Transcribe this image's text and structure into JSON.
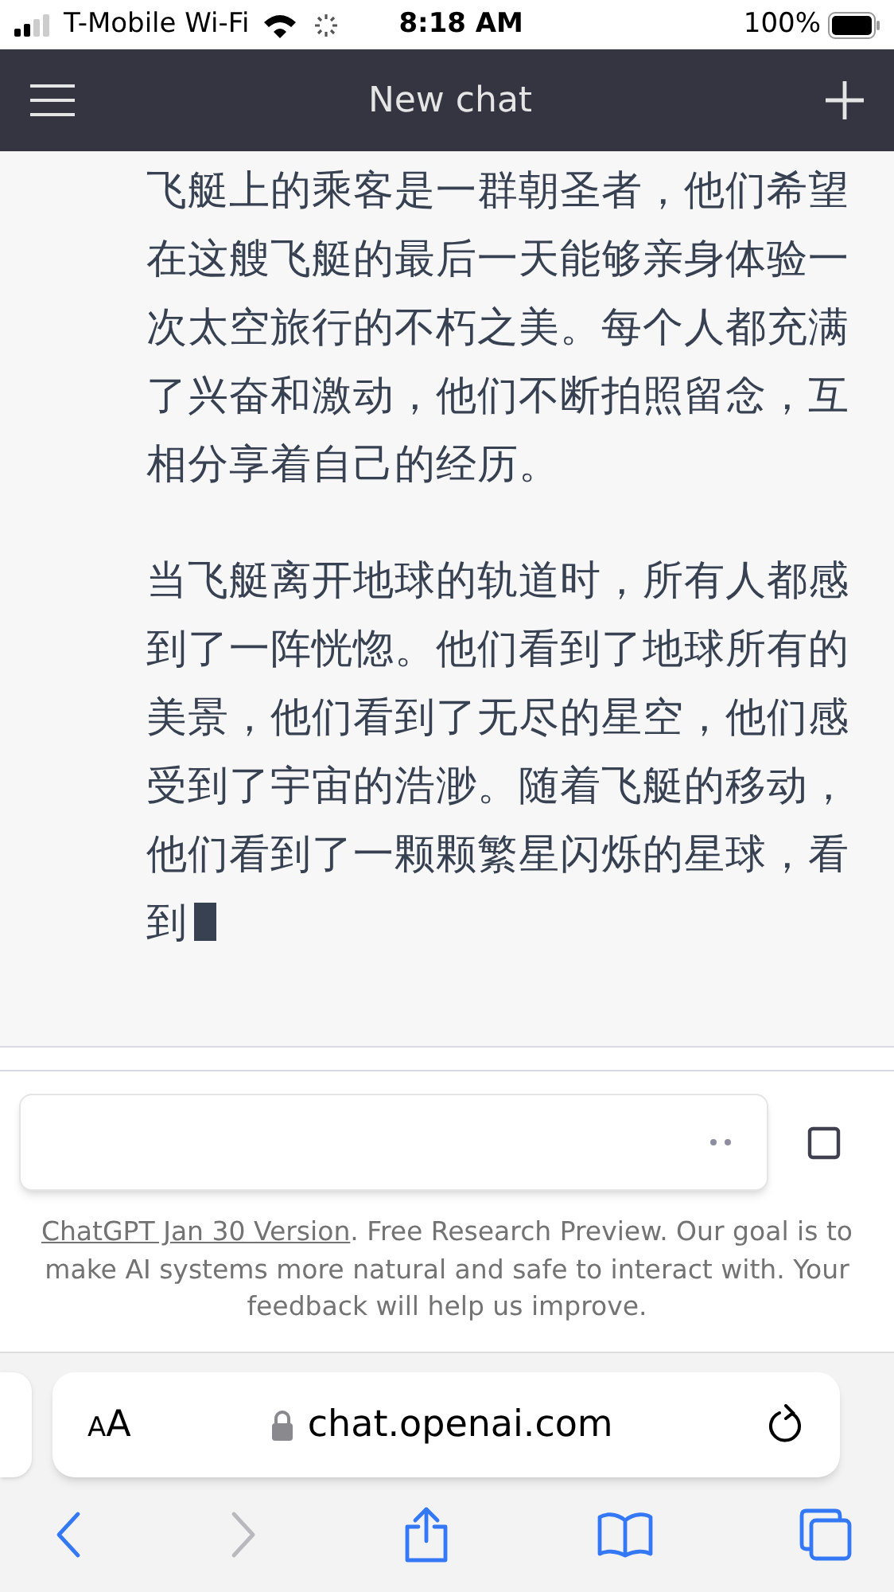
{
  "status_bar": {
    "carrier": "T-Mobile Wi-Fi",
    "time": "8:18 AM",
    "battery": "100%"
  },
  "header": {
    "title": "New chat"
  },
  "messages": [
    {
      "text": "飞艇上的乘客是一群朝圣者，他们希望在这艘飞艇的最后一天能够亲身体验一次太空旅行的不朽之美。每个人都充满了兴奋和激动，他们不断拍照留念，互相分享着自己的经历。",
      "streaming": false
    },
    {
      "text": "当飞艇离开地球的轨道时，所有人都感到了一阵恍惚。他们看到了地球所有的美景，他们看到了无尽的星空，他们感受到了宇宙的浩渺。随着飞艇的移动，他们看到了一颗颗繁星闪烁的星球，看到",
      "streaming": true
    }
  ],
  "composer": {
    "loading": true
  },
  "footer": {
    "link": "ChatGPT Jan 30 Version",
    "text": ". Free Research Preview. Our goal is to make AI systems more natural and safe to interact with. Your feedback will help us improve."
  },
  "browser": {
    "text_size": "AA",
    "url": "chat.openai.com"
  },
  "toolbar": [
    {
      "kind": "back",
      "disabled": false
    },
    {
      "kind": "forward",
      "disabled": true
    },
    {
      "kind": "share",
      "disabled": false
    },
    {
      "kind": "bookmarks",
      "disabled": false
    },
    {
      "kind": "tabs",
      "disabled": false
    }
  ]
}
